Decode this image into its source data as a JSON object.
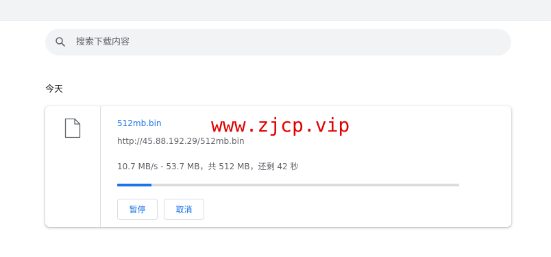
{
  "search": {
    "placeholder": "搜索下载内容",
    "value": ""
  },
  "date_heading": "今天",
  "download": {
    "file_name": "512mb.bin",
    "url": "http://45.88.192.29/512mb.bin",
    "status": "10.7 MB/s - 53.7 MB，共 512 MB，还剩 42 秒",
    "progress_fraction": 0.1,
    "pause_label": "暂停",
    "cancel_label": "取消"
  },
  "watermark": "www.zjcp.vip",
  "colors": {
    "accent": "#1a73e8",
    "watermark": "#e00000",
    "topbar": "#f1f3f4"
  },
  "icons": {
    "search": "search-icon",
    "file": "file-icon"
  }
}
